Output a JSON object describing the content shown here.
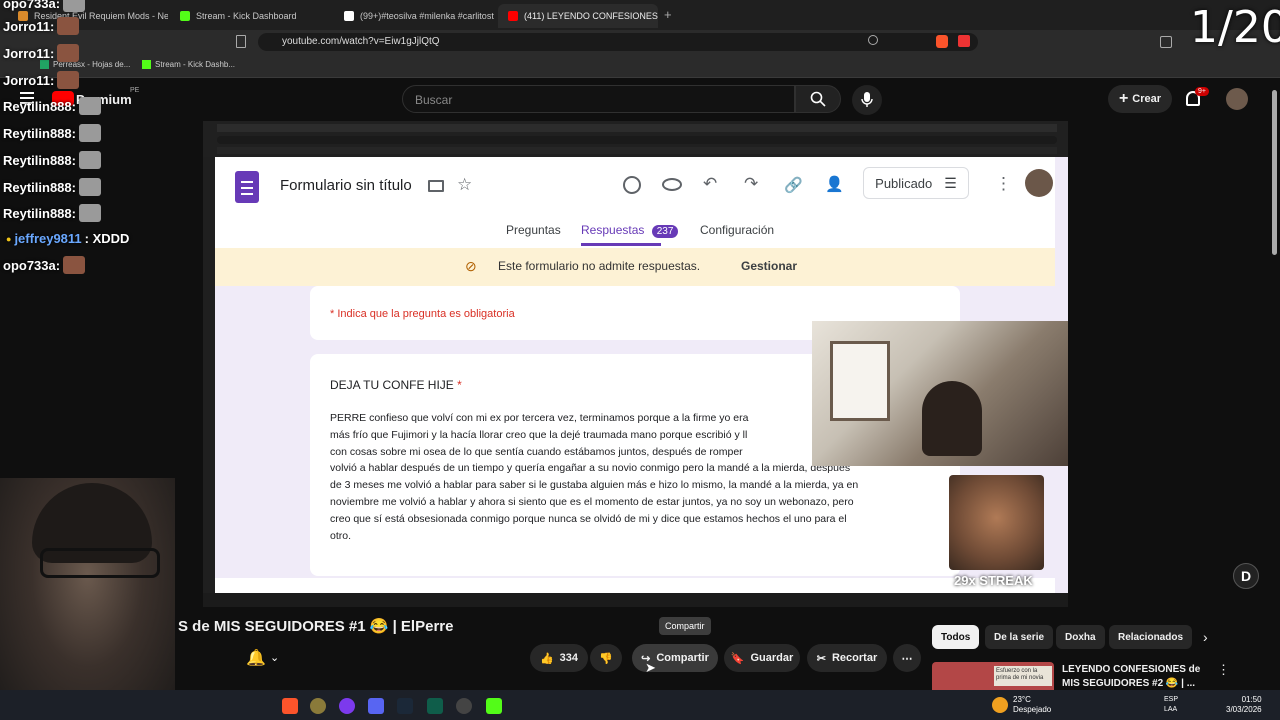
{
  "browser": {
    "tabs": [
      {
        "label": "Resident Evil Requiem Mods - Nexus",
        "color": "#d98a2b"
      },
      {
        "label": "Stream - Kick Dashboard",
        "color": "#53fc18"
      },
      {
        "label": "(99+)#teosilva #milenka #carlitostv #",
        "color": "#ffffff"
      },
      {
        "label": "(411) LEYENDO CONFESIONES",
        "color": "#ff0000"
      }
    ],
    "url": "youtube.com/watch?v=Eiw1gJjlQtQ",
    "bookmarks": [
      "Perreasx - Hojas de...",
      "Stream - Kick Dashb..."
    ]
  },
  "youtube": {
    "premium_label": "Premium",
    "region": "PE",
    "search_placeholder": "Buscar",
    "create_label": "Crear",
    "notif_count": "9+"
  },
  "overlay": {
    "counter": "1/20",
    "streak": "29x STREAK",
    "chat": [
      {
        "user": "opo733a:",
        "text": "",
        "color": "#ffffff"
      },
      {
        "user": "Jorro11:",
        "text": "",
        "color": "#ffffff"
      },
      {
        "user": "Jorro11:",
        "text": "",
        "color": "#ffffff"
      },
      {
        "user": "Jorro11:",
        "text": "",
        "color": "#ffffff"
      },
      {
        "user": "Reytilin888:",
        "text": "",
        "color": "#ffffff"
      },
      {
        "user": "Reytilin888:",
        "text": "",
        "color": "#ffffff"
      },
      {
        "user": "Reytilin888:",
        "text": "",
        "color": "#ffffff"
      },
      {
        "user": "Reytilin888:",
        "text": "",
        "color": "#ffffff"
      },
      {
        "user": "Reytilin888:",
        "text": "",
        "color": "#ffffff"
      },
      {
        "user": "jeffrey9811",
        "text": ": XDDD",
        "color": "#6aa8ff"
      },
      {
        "user": "opo733a:",
        "text": "",
        "color": "#ffffff"
      }
    ]
  },
  "form": {
    "title": "Formulario sin título",
    "published_label": "Publicado",
    "tabs": {
      "questions": "Preguntas",
      "responses": "Respuestas",
      "responses_count": "237",
      "settings": "Configuración"
    },
    "banner_text": "Este formulario no admite respuestas.",
    "banner_action": "Gestionar",
    "required_note": "* Indica que la pregunta es obligatoria",
    "question_title": "DEJA TU CONFE HIJE",
    "answer_lines": [
      "PERRE confieso que volví con mi ex por tercera vez,  terminamos porque a la firme yo era",
      "más frío que Fujimori y la hacía llorar creo que la dejé traumada mano porque escribió y ll",
      "con cosas sobre mi osea de lo que sentía cuando estábamos juntos, después de romper",
      "volvió a hablar después de un tiempo y quería engañar a su novio conmigo pero la mandé a la mierda, después",
      "de 3 meses me volvió a hablar para saber si le gustaba alguien más e hizo lo mismo, la mandé a la mierda, ya en",
      "noviembre me volvió a hablar y ahora si siento que es el momento de estar juntos, ya no soy un webonazo, pero",
      "creo que sí está obsesionada conmigo porque nunca se olvidó de mi y dice que estamos hechos el uno para el",
      "otro."
    ]
  },
  "video": {
    "title_fragment": "S de MIS SEGUIDORES #1 😂 | ElPerre",
    "like_count": "334",
    "share_label": "Compartir",
    "share_tooltip": "Compartir",
    "save_label": "Guardar",
    "clip_label": "Recortar"
  },
  "sidebar": {
    "chips": [
      "Todos",
      "De la serie",
      "Doxha",
      "Relacionados"
    ],
    "rec_title_line1": "LEYENDO CONFESIONES de",
    "rec_title_line2": "MIS SEGUIDORES #2 😂 | ...",
    "rec_thumb_text": "Esfuerzo con la prima de mi novia"
  },
  "taskbar": {
    "weather_temp": "23°C",
    "weather_desc": "Despejado",
    "lang": "ESP",
    "lang2": "LAA",
    "time": "01:50",
    "date": "3/03/2026"
  }
}
